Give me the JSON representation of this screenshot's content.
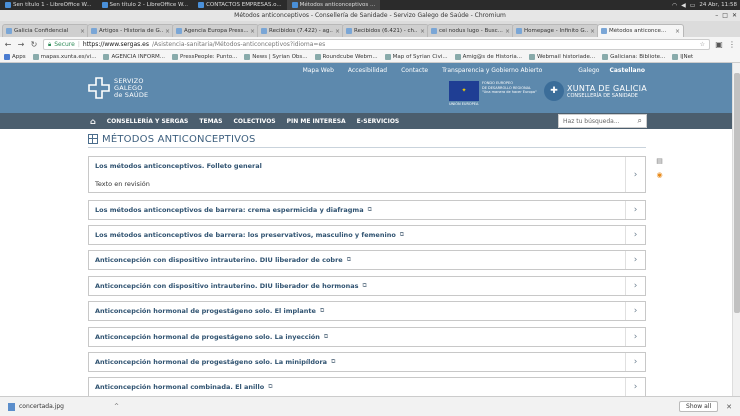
{
  "os": {
    "tasks": [
      {
        "label": "Sen título 1 - LibreOffice W..."
      },
      {
        "label": "Sen título 2 - LibreOffice W..."
      },
      {
        "label": "CONTACTOS EMPRESAS.o..."
      },
      {
        "label": "Métodos anticonceptivos ..."
      }
    ],
    "clock": "24 Abr, 11:58"
  },
  "window": {
    "title": "Métodos anticonceptivos - Consellería de Sanidade - Servizo Galego de Saúde - Chromium"
  },
  "tabs": [
    {
      "label": "Galicia Confidencial"
    },
    {
      "label": "Artigos - Historia de G..."
    },
    {
      "label": "Agencia Europa Press..."
    },
    {
      "label": "Recibidos (7.422) - ag..."
    },
    {
      "label": "Recibidos (6.421) - ch..."
    },
    {
      "label": "cei nodus lugo - Busc..."
    },
    {
      "label": "Homepage - Infinito G..."
    },
    {
      "label": "Métodos anticonce..."
    }
  ],
  "address": {
    "secure_label": "Secure",
    "host": "https://www.sergas.es",
    "path": "/Asistencia-sanitaria/Métodos-anticonceptivos?idioma=es"
  },
  "bookmarks": [
    {
      "label": "Apps"
    },
    {
      "label": "mapas.xunta.es/vi..."
    },
    {
      "label": "AGENCIA INFORM..."
    },
    {
      "label": "PressPeople: Punto..."
    },
    {
      "label": "News | Syrian Obs..."
    },
    {
      "label": "Roundcube Webm..."
    },
    {
      "label": "Map of Syrian Civi..."
    },
    {
      "label": "Amig@s de Historia..."
    },
    {
      "label": "Webmail historiade..."
    },
    {
      "label": "Galiciana: Bibliote..."
    },
    {
      "label": "IJNet"
    }
  ],
  "header": {
    "links": [
      "Mapa Web",
      "Accesibilidad",
      "Contacte",
      "Transparencia y Gobierno Abierto"
    ],
    "langs": [
      "Galego",
      "Castellano"
    ],
    "logo_lines": [
      "SERVIZO",
      "GALEGO",
      "de SAÚDE"
    ],
    "eu_text": [
      "FONDO EUROPEO",
      "DE DESARROLLO REGIONAL",
      "\"Una manera de hacer Europa\"",
      "UNIÓN EUROPEA"
    ],
    "xunta_name": "XUNTA DE GALICIA",
    "xunta_sub": "CONSELLERÍA DE SANIDADE"
  },
  "nav": {
    "items": [
      "CONSELLERÍA Y SERGAS",
      "TEMAS",
      "COLECTIVOS",
      "PIN ME INTERESA",
      "E-SERVICIOS"
    ],
    "search_placeholder": "Haz tu búsqueda..."
  },
  "page": {
    "title": "MÉTODOS ANTICONCEPTIVOS",
    "first_item": {
      "title": "Los métodos anticonceptivos. Folleto general",
      "subtitle": "Texto en revisión"
    },
    "items": [
      "Los métodos anticonceptivos de barrera: crema espermicida y diafragma",
      "Los métodos anticonceptivos de barrera: los preservativos, masculino y femenino",
      "Anticoncepción con dispositivo intrauterino. DIU liberador de cobre",
      "Anticoncepción con dispositivo intrauterino. DIU liberador de hormonas",
      "Anticoncepción hormonal de progestágeno solo. El implante",
      "Anticoncepción hormonal de progestágeno solo. La inyección",
      "Anticoncepción hormonal de progestágeno solo. La minipíldora",
      "Anticoncepción hormonal combinada. El anillo"
    ]
  },
  "downloads": {
    "file": "concertada.jpg",
    "show_all": "Show all"
  }
}
